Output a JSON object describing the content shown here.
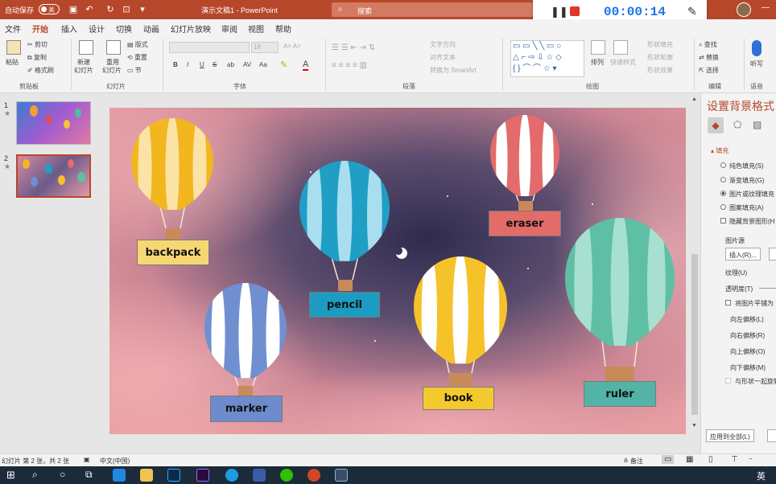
{
  "titlebar": {
    "autosave_label": "自动保存",
    "autosave_state": "关",
    "doc_title": "演示文稿1  -  PowerPoint",
    "search_placeholder": "搜索"
  },
  "recorder": {
    "time": "00:00:14"
  },
  "tabs": [
    "文件",
    "开始",
    "插入",
    "设计",
    "切换",
    "动画",
    "幻灯片放映",
    "审阅",
    "视图",
    "帮助"
  ],
  "active_tab": "开始",
  "ribbon": {
    "clipboard": {
      "paste": "粘贴",
      "cut": "剪切",
      "copy": "复制",
      "format_painter": "格式刷",
      "label": "剪贴板"
    },
    "slides": {
      "new_slide": "新建",
      "new_slide2": "幻灯片",
      "reuse": "重用",
      "reuse2": "幻灯片",
      "layout": "版式",
      "reset": "重置",
      "section": "节",
      "label": "幻灯片"
    },
    "font": {
      "size": "18",
      "label": "字体",
      "bold": "B",
      "italic": "I",
      "underline": "U",
      "strike": "S",
      "shadow": "ab",
      "spacing": "AV",
      "case": "Aa",
      "color": "A"
    },
    "paragraph": {
      "text_dir": "文字方向",
      "align_text": "对齐文本",
      "smartart": "转换为 SmartArt",
      "label": "段落"
    },
    "drawing": {
      "arrange": "排列",
      "quick_styles": "快速样式",
      "fill": "形状填充",
      "outline": "形状轮廓",
      "effects": "形状效果",
      "label": "绘图"
    },
    "editing": {
      "find": "查找",
      "replace": "替换",
      "select": "选择",
      "label": "编辑"
    },
    "voice": {
      "dictate": "听写",
      "label": "语音"
    }
  },
  "thumbs": [
    {
      "num": "1"
    },
    {
      "num": "2"
    }
  ],
  "slide": {
    "balloons": [
      {
        "name": "backpack",
        "label": "backpack",
        "color": "#f2b61f",
        "light": "#fbe3a5",
        "box": "#f7d774"
      },
      {
        "name": "pencil",
        "label": "pencil",
        "color": "#1f9fc4",
        "light": "#a9def0",
        "box": "#1c9cc2"
      },
      {
        "name": "eraser",
        "label": "eraser",
        "color": "#e46b6b",
        "light": "#ffffff",
        "box": "#e36b68"
      },
      {
        "name": "marker",
        "label": "marker",
        "color": "#6f8fd0",
        "light": "#ffffff",
        "box": "#6e8ccd"
      },
      {
        "name": "book",
        "label": "book",
        "color": "#f5c22a",
        "light": "#ffffff",
        "box": "#f4c92e"
      },
      {
        "name": "ruler",
        "label": "ruler",
        "color": "#5fbfa5",
        "light": "#a8e0d0",
        "box": "#52b3a6"
      }
    ]
  },
  "pane": {
    "title": "设置背景格式",
    "section": "填充",
    "options": [
      "纯色填充(S)",
      "渐变填充(G)",
      "图片或纹理填充",
      "图案填充(A)"
    ],
    "hide_graphics": "隐藏背景图形(H",
    "picture_source": "图片源",
    "insert_btn": "插入(R)...",
    "texture": "纹理(U)",
    "transparency": "透明度(T)",
    "tile": "将图片平铺为",
    "offsets": [
      "向左偏移(L)",
      "向右偏移(R)",
      "向上偏移(O)",
      "向下偏移(M)"
    ],
    "rotate_with_shape": "与形状一起旋转",
    "apply_all": "应用到全部(L)"
  },
  "status": {
    "slide_info": "幻灯片 第 2 张，共 2 张",
    "language": "中文(中国)",
    "notes": "备注"
  },
  "taskbar": {
    "ime": "英"
  }
}
